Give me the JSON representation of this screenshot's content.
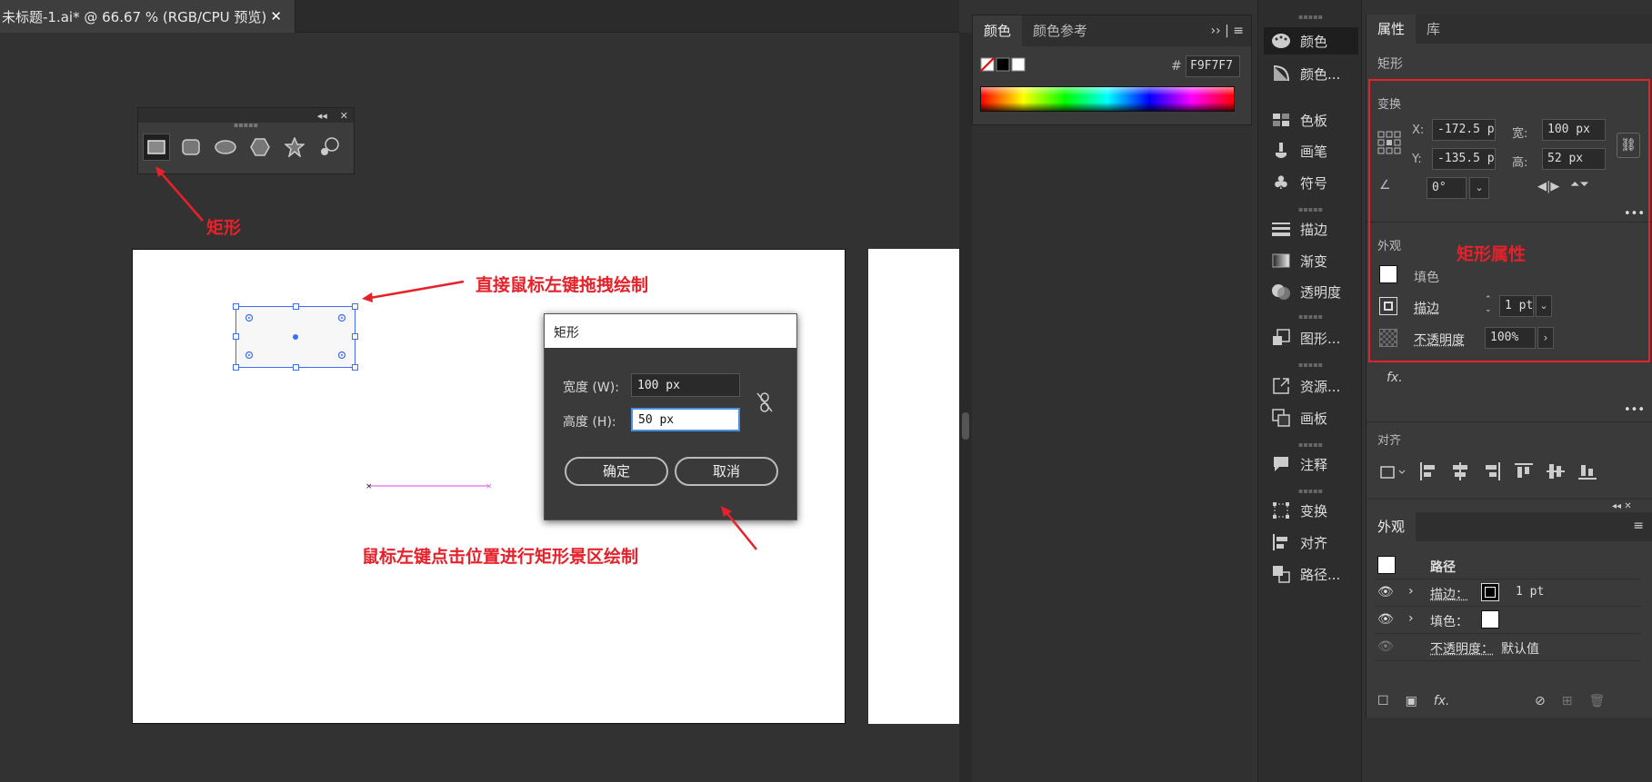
{
  "document": {
    "tab_title": "未标题-1.ai* @ 66.67 % (RGB/CPU 预览)",
    "close": "✕"
  },
  "shape_tools": {
    "names": [
      "rectangle-tool",
      "rounded-rectangle-tool",
      "ellipse-tool",
      "polygon-tool",
      "star-tool",
      "flare-tool"
    ]
  },
  "annotations": {
    "rect_label": "矩形",
    "drag_label": "直接鼠标左键拖拽绘制",
    "click_label": "鼠标左键点击位置进行矩形景区绘制",
    "props_label": "矩形属性"
  },
  "dialog": {
    "title": "矩形",
    "width_label": "宽度 (W):",
    "width_value": "100 px",
    "height_label": "高度 (H):",
    "height_value": "50 px",
    "ok": "确定",
    "cancel": "取消"
  },
  "color_panel": {
    "tab_color": "颜色",
    "tab_guide": "颜色参考",
    "hex_label": "#",
    "hex_value": "F9F7F7",
    "more": "»"
  },
  "strip": {
    "items": [
      {
        "label": "颜色",
        "icon": "palette-icon"
      },
      {
        "label": "颜色...",
        "icon": "color-guide-icon"
      },
      {
        "label": "色板",
        "icon": "swatches-icon"
      },
      {
        "label": "画笔",
        "icon": "brush-icon"
      },
      {
        "label": "符号",
        "icon": "club-icon"
      },
      {
        "label": "描边",
        "icon": "stroke-icon"
      },
      {
        "label": "渐变",
        "icon": "gradient-icon"
      },
      {
        "label": "透明度",
        "icon": "transparency-icon"
      },
      {
        "label": "图形...",
        "icon": "graphic-styles-icon"
      },
      {
        "label": "资源...",
        "icon": "export-icon"
      },
      {
        "label": "画板",
        "icon": "artboard-icon"
      },
      {
        "label": "注释",
        "icon": "comment-icon"
      },
      {
        "label": "变换",
        "icon": "transform-icon"
      },
      {
        "label": "对齐",
        "icon": "align-icon"
      },
      {
        "label": "路径...",
        "icon": "pathfinder-icon"
      }
    ]
  },
  "properties": {
    "tab_props": "属性",
    "tab_library": "库",
    "object_type": "矩形",
    "transform_heading": "变换",
    "x_label": "X:",
    "x_value": "-172.5 p",
    "y_label": "Y:",
    "y_value": "-135.5 p",
    "w_label": "宽:",
    "w_value": "100 px",
    "h_label": "高:",
    "h_value": "52 px",
    "angle_value": "0°",
    "appearance_heading": "外观",
    "fill_label": "填色",
    "stroke_label": "描边",
    "stroke_value": "1 pt",
    "opacity_label": "不透明度",
    "opacity_value": "100%",
    "fx": "fx.",
    "align_heading": "对齐",
    "more": "•••"
  },
  "appearance_panel": {
    "title": "外观",
    "path_label": "路径",
    "stroke_label": "描边：",
    "stroke_value": "1 pt",
    "fill_label": "填色：",
    "opacity_label": "不透明度：",
    "opacity_value": "默认值",
    "fx": "fx."
  },
  "colors": {
    "annotation": "#e6212a",
    "selection": "#3d6ff5",
    "fill": "#F9F7F7"
  }
}
